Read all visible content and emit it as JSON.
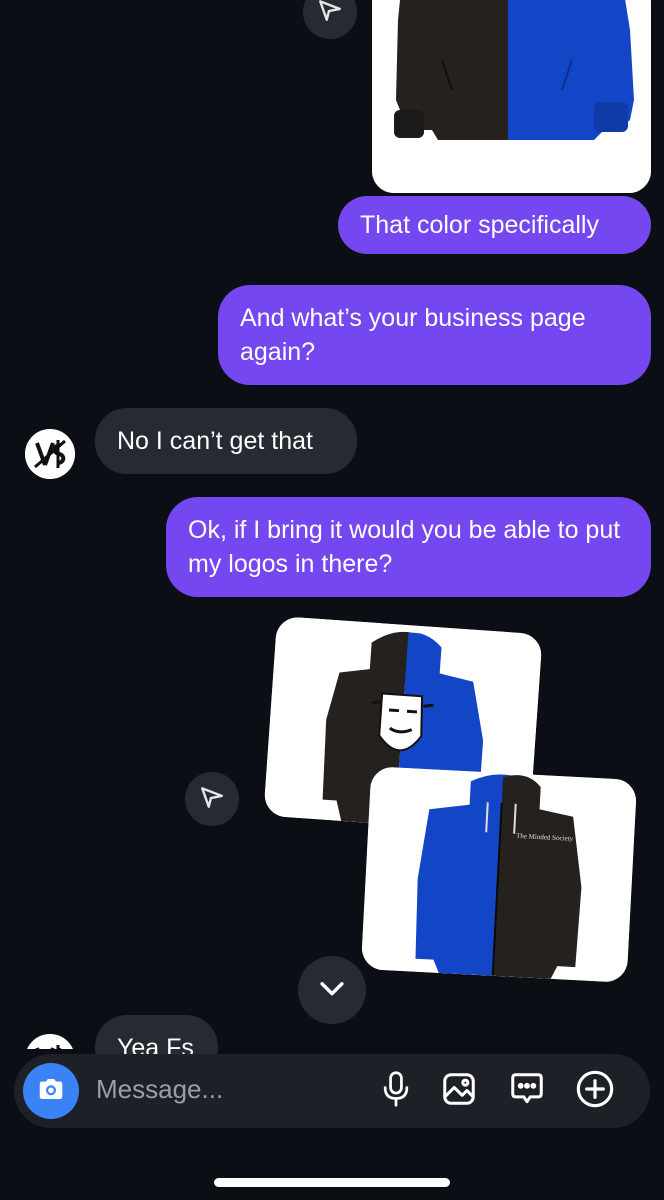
{
  "messages": [
    {
      "id": "m1",
      "side": "out",
      "text": "That color specifically"
    },
    {
      "id": "m2",
      "side": "out",
      "text": "And what’s your business page again?"
    },
    {
      "id": "m3",
      "side": "in",
      "text": "No I can’t get that"
    },
    {
      "id": "m4",
      "side": "out",
      "text": "Ok, if I bring it would you be able to put my logos in there?"
    },
    {
      "id": "m5",
      "side": "in",
      "text": "Yea Fs"
    }
  ],
  "attachments": {
    "logo_text_small": "The Minded Society"
  },
  "composer": {
    "placeholder": "Message..."
  },
  "icons": {
    "camera": "camera-icon",
    "mic": "microphone-icon",
    "gallery": "gallery-icon",
    "sticker": "chat-bubble-icon",
    "add": "plus-circle-icon",
    "share": "send-arrow-icon",
    "scroll": "chevron-down-icon"
  },
  "colors": {
    "background": "#0b0e14",
    "outgoing_bubble": "#7447f0",
    "incoming_bubble": "#262a33",
    "hoodie_blue": "#1346c6",
    "hoodie_black": "#24211f",
    "camera_button": "#3b82f6"
  }
}
